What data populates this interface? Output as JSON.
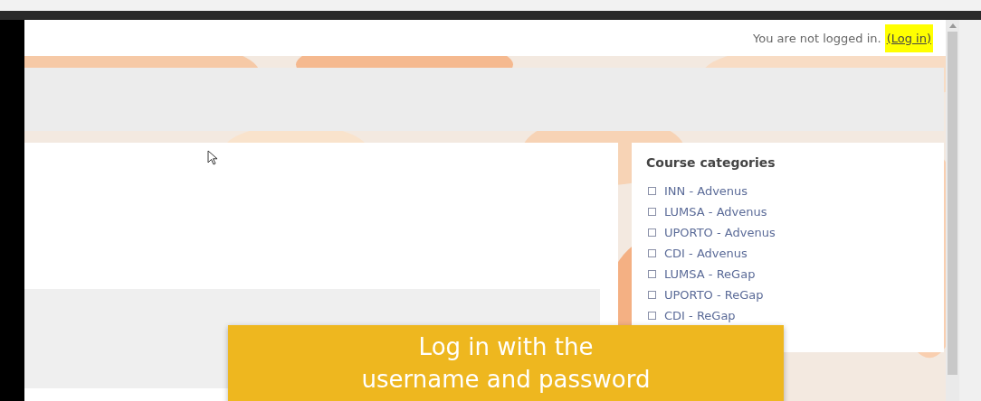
{
  "header": {
    "status_text": "You are not logged in.",
    "login_link": "(Log in)",
    "login_highlighted": true
  },
  "course_categories": {
    "title": "Course categories",
    "items": [
      {
        "label": "INN - Advenus"
      },
      {
        "label": "LUMSA - Advenus"
      },
      {
        "label": "UPORTO - Advenus"
      },
      {
        "label": "CDI - Advenus"
      },
      {
        "label": "LUMSA - ReGap"
      },
      {
        "label": "UPORTO - ReGap"
      },
      {
        "label": "CDI - ReGap"
      }
    ]
  },
  "caption": {
    "lines": [
      "Log in with the",
      "username and password"
    ]
  }
}
